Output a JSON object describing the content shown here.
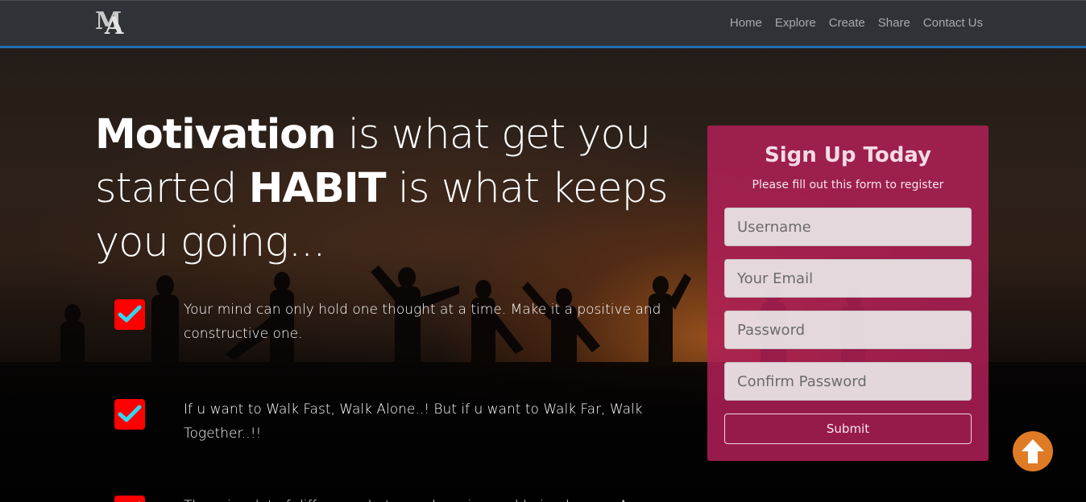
{
  "nav": {
    "logo_text": "MA",
    "links": [
      "Home",
      "Explore",
      "Create",
      "Share",
      "Contact Us"
    ]
  },
  "hero": {
    "headline_bold_1": "Motivation",
    "headline_mid": " is what get you started ",
    "headline_bold_2": "HABIT",
    "headline_end": " is what keeps you going...",
    "features": [
      "Your mind can only hold one thought at a time. Make it a positive and constructive one.",
      "If u want to Walk Fast, Walk Alone..! But if u want to Walk Far, Walk Together..!!",
      "There is a lot of difference between knowing and being known. A"
    ]
  },
  "signup": {
    "title": "Sign Up Today",
    "subtitle": "Please fill out this form to register",
    "username_placeholder": "Username",
    "email_placeholder": "Your Email",
    "password_placeholder": "Password",
    "confirm_placeholder": "Confirm Password",
    "submit_label": "Submit"
  },
  "icons": {
    "check": "check-icon",
    "scroll_top": "arrow-up-icon"
  },
  "colors": {
    "navbar": "#2f3237",
    "nav_border": "#1e6fb3",
    "form_bg": "#b02056",
    "checkbox": "#ff0000",
    "checkmark": "#33d6ee",
    "scroll_button": "#e07b25"
  }
}
